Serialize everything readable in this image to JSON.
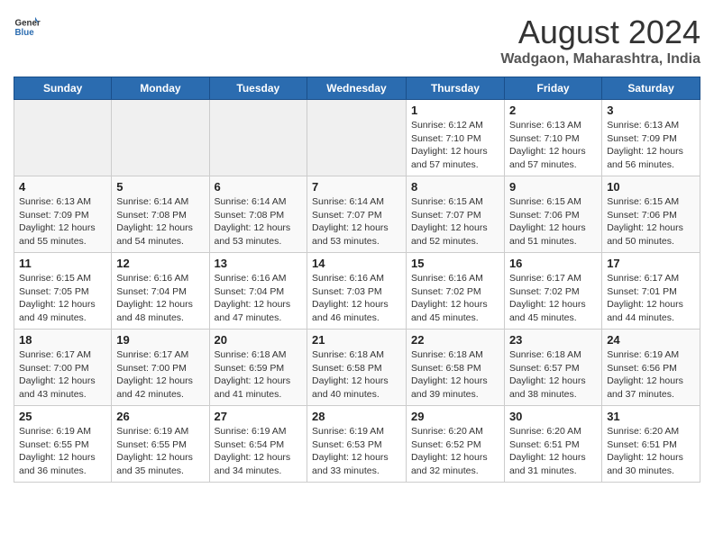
{
  "logo": {
    "line1": "General",
    "line2": "Blue"
  },
  "title": "August 2024",
  "subtitle": "Wadgaon, Maharashtra, India",
  "days_of_week": [
    "Sunday",
    "Monday",
    "Tuesday",
    "Wednesday",
    "Thursday",
    "Friday",
    "Saturday"
  ],
  "weeks": [
    [
      {
        "day": "",
        "info": ""
      },
      {
        "day": "",
        "info": ""
      },
      {
        "day": "",
        "info": ""
      },
      {
        "day": "",
        "info": ""
      },
      {
        "day": "1",
        "info": "Sunrise: 6:12 AM\nSunset: 7:10 PM\nDaylight: 12 hours\nand 57 minutes."
      },
      {
        "day": "2",
        "info": "Sunrise: 6:13 AM\nSunset: 7:10 PM\nDaylight: 12 hours\nand 57 minutes."
      },
      {
        "day": "3",
        "info": "Sunrise: 6:13 AM\nSunset: 7:09 PM\nDaylight: 12 hours\nand 56 minutes."
      }
    ],
    [
      {
        "day": "4",
        "info": "Sunrise: 6:13 AM\nSunset: 7:09 PM\nDaylight: 12 hours\nand 55 minutes."
      },
      {
        "day": "5",
        "info": "Sunrise: 6:14 AM\nSunset: 7:08 PM\nDaylight: 12 hours\nand 54 minutes."
      },
      {
        "day": "6",
        "info": "Sunrise: 6:14 AM\nSunset: 7:08 PM\nDaylight: 12 hours\nand 53 minutes."
      },
      {
        "day": "7",
        "info": "Sunrise: 6:14 AM\nSunset: 7:07 PM\nDaylight: 12 hours\nand 53 minutes."
      },
      {
        "day": "8",
        "info": "Sunrise: 6:15 AM\nSunset: 7:07 PM\nDaylight: 12 hours\nand 52 minutes."
      },
      {
        "day": "9",
        "info": "Sunrise: 6:15 AM\nSunset: 7:06 PM\nDaylight: 12 hours\nand 51 minutes."
      },
      {
        "day": "10",
        "info": "Sunrise: 6:15 AM\nSunset: 7:06 PM\nDaylight: 12 hours\nand 50 minutes."
      }
    ],
    [
      {
        "day": "11",
        "info": "Sunrise: 6:15 AM\nSunset: 7:05 PM\nDaylight: 12 hours\nand 49 minutes."
      },
      {
        "day": "12",
        "info": "Sunrise: 6:16 AM\nSunset: 7:04 PM\nDaylight: 12 hours\nand 48 minutes."
      },
      {
        "day": "13",
        "info": "Sunrise: 6:16 AM\nSunset: 7:04 PM\nDaylight: 12 hours\nand 47 minutes."
      },
      {
        "day": "14",
        "info": "Sunrise: 6:16 AM\nSunset: 7:03 PM\nDaylight: 12 hours\nand 46 minutes."
      },
      {
        "day": "15",
        "info": "Sunrise: 6:16 AM\nSunset: 7:02 PM\nDaylight: 12 hours\nand 45 minutes."
      },
      {
        "day": "16",
        "info": "Sunrise: 6:17 AM\nSunset: 7:02 PM\nDaylight: 12 hours\nand 45 minutes."
      },
      {
        "day": "17",
        "info": "Sunrise: 6:17 AM\nSunset: 7:01 PM\nDaylight: 12 hours\nand 44 minutes."
      }
    ],
    [
      {
        "day": "18",
        "info": "Sunrise: 6:17 AM\nSunset: 7:00 PM\nDaylight: 12 hours\nand 43 minutes."
      },
      {
        "day": "19",
        "info": "Sunrise: 6:17 AM\nSunset: 7:00 PM\nDaylight: 12 hours\nand 42 minutes."
      },
      {
        "day": "20",
        "info": "Sunrise: 6:18 AM\nSunset: 6:59 PM\nDaylight: 12 hours\nand 41 minutes."
      },
      {
        "day": "21",
        "info": "Sunrise: 6:18 AM\nSunset: 6:58 PM\nDaylight: 12 hours\nand 40 minutes."
      },
      {
        "day": "22",
        "info": "Sunrise: 6:18 AM\nSunset: 6:58 PM\nDaylight: 12 hours\nand 39 minutes."
      },
      {
        "day": "23",
        "info": "Sunrise: 6:18 AM\nSunset: 6:57 PM\nDaylight: 12 hours\nand 38 minutes."
      },
      {
        "day": "24",
        "info": "Sunrise: 6:19 AM\nSunset: 6:56 PM\nDaylight: 12 hours\nand 37 minutes."
      }
    ],
    [
      {
        "day": "25",
        "info": "Sunrise: 6:19 AM\nSunset: 6:55 PM\nDaylight: 12 hours\nand 36 minutes."
      },
      {
        "day": "26",
        "info": "Sunrise: 6:19 AM\nSunset: 6:55 PM\nDaylight: 12 hours\nand 35 minutes."
      },
      {
        "day": "27",
        "info": "Sunrise: 6:19 AM\nSunset: 6:54 PM\nDaylight: 12 hours\nand 34 minutes."
      },
      {
        "day": "28",
        "info": "Sunrise: 6:19 AM\nSunset: 6:53 PM\nDaylight: 12 hours\nand 33 minutes."
      },
      {
        "day": "29",
        "info": "Sunrise: 6:20 AM\nSunset: 6:52 PM\nDaylight: 12 hours\nand 32 minutes."
      },
      {
        "day": "30",
        "info": "Sunrise: 6:20 AM\nSunset: 6:51 PM\nDaylight: 12 hours\nand 31 minutes."
      },
      {
        "day": "31",
        "info": "Sunrise: 6:20 AM\nSunset: 6:51 PM\nDaylight: 12 hours\nand 30 minutes."
      }
    ]
  ]
}
